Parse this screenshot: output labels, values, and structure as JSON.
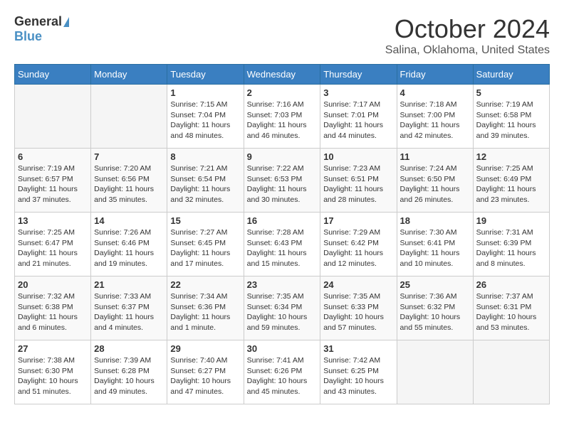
{
  "header": {
    "logo_general": "General",
    "logo_blue": "Blue",
    "month_title": "October 2024",
    "location": "Salina, Oklahoma, United States"
  },
  "weekdays": [
    "Sunday",
    "Monday",
    "Tuesday",
    "Wednesday",
    "Thursday",
    "Friday",
    "Saturday"
  ],
  "weeks": [
    [
      {
        "day": "",
        "empty": true
      },
      {
        "day": "",
        "empty": true
      },
      {
        "day": "1",
        "sunrise": "7:15 AM",
        "sunset": "7:04 PM",
        "daylight": "11 hours and 48 minutes."
      },
      {
        "day": "2",
        "sunrise": "7:16 AM",
        "sunset": "7:03 PM",
        "daylight": "11 hours and 46 minutes."
      },
      {
        "day": "3",
        "sunrise": "7:17 AM",
        "sunset": "7:01 PM",
        "daylight": "11 hours and 44 minutes."
      },
      {
        "day": "4",
        "sunrise": "7:18 AM",
        "sunset": "7:00 PM",
        "daylight": "11 hours and 42 minutes."
      },
      {
        "day": "5",
        "sunrise": "7:19 AM",
        "sunset": "6:58 PM",
        "daylight": "11 hours and 39 minutes."
      }
    ],
    [
      {
        "day": "6",
        "sunrise": "7:19 AM",
        "sunset": "6:57 PM",
        "daylight": "11 hours and 37 minutes."
      },
      {
        "day": "7",
        "sunrise": "7:20 AM",
        "sunset": "6:56 PM",
        "daylight": "11 hours and 35 minutes."
      },
      {
        "day": "8",
        "sunrise": "7:21 AM",
        "sunset": "6:54 PM",
        "daylight": "11 hours and 32 minutes."
      },
      {
        "day": "9",
        "sunrise": "7:22 AM",
        "sunset": "6:53 PM",
        "daylight": "11 hours and 30 minutes."
      },
      {
        "day": "10",
        "sunrise": "7:23 AM",
        "sunset": "6:51 PM",
        "daylight": "11 hours and 28 minutes."
      },
      {
        "day": "11",
        "sunrise": "7:24 AM",
        "sunset": "6:50 PM",
        "daylight": "11 hours and 26 minutes."
      },
      {
        "day": "12",
        "sunrise": "7:25 AM",
        "sunset": "6:49 PM",
        "daylight": "11 hours and 23 minutes."
      }
    ],
    [
      {
        "day": "13",
        "sunrise": "7:25 AM",
        "sunset": "6:47 PM",
        "daylight": "11 hours and 21 minutes."
      },
      {
        "day": "14",
        "sunrise": "7:26 AM",
        "sunset": "6:46 PM",
        "daylight": "11 hours and 19 minutes."
      },
      {
        "day": "15",
        "sunrise": "7:27 AM",
        "sunset": "6:45 PM",
        "daylight": "11 hours and 17 minutes."
      },
      {
        "day": "16",
        "sunrise": "7:28 AM",
        "sunset": "6:43 PM",
        "daylight": "11 hours and 15 minutes."
      },
      {
        "day": "17",
        "sunrise": "7:29 AM",
        "sunset": "6:42 PM",
        "daylight": "11 hours and 12 minutes."
      },
      {
        "day": "18",
        "sunrise": "7:30 AM",
        "sunset": "6:41 PM",
        "daylight": "11 hours and 10 minutes."
      },
      {
        "day": "19",
        "sunrise": "7:31 AM",
        "sunset": "6:39 PM",
        "daylight": "11 hours and 8 minutes."
      }
    ],
    [
      {
        "day": "20",
        "sunrise": "7:32 AM",
        "sunset": "6:38 PM",
        "daylight": "11 hours and 6 minutes."
      },
      {
        "day": "21",
        "sunrise": "7:33 AM",
        "sunset": "6:37 PM",
        "daylight": "11 hours and 4 minutes."
      },
      {
        "day": "22",
        "sunrise": "7:34 AM",
        "sunset": "6:36 PM",
        "daylight": "11 hours and 1 minute."
      },
      {
        "day": "23",
        "sunrise": "7:35 AM",
        "sunset": "6:34 PM",
        "daylight": "10 hours and 59 minutes."
      },
      {
        "day": "24",
        "sunrise": "7:35 AM",
        "sunset": "6:33 PM",
        "daylight": "10 hours and 57 minutes."
      },
      {
        "day": "25",
        "sunrise": "7:36 AM",
        "sunset": "6:32 PM",
        "daylight": "10 hours and 55 minutes."
      },
      {
        "day": "26",
        "sunrise": "7:37 AM",
        "sunset": "6:31 PM",
        "daylight": "10 hours and 53 minutes."
      }
    ],
    [
      {
        "day": "27",
        "sunrise": "7:38 AM",
        "sunset": "6:30 PM",
        "daylight": "10 hours and 51 minutes."
      },
      {
        "day": "28",
        "sunrise": "7:39 AM",
        "sunset": "6:28 PM",
        "daylight": "10 hours and 49 minutes."
      },
      {
        "day": "29",
        "sunrise": "7:40 AM",
        "sunset": "6:27 PM",
        "daylight": "10 hours and 47 minutes."
      },
      {
        "day": "30",
        "sunrise": "7:41 AM",
        "sunset": "6:26 PM",
        "daylight": "10 hours and 45 minutes."
      },
      {
        "day": "31",
        "sunrise": "7:42 AM",
        "sunset": "6:25 PM",
        "daylight": "10 hours and 43 minutes."
      },
      {
        "day": "",
        "empty": true
      },
      {
        "day": "",
        "empty": true
      }
    ]
  ]
}
